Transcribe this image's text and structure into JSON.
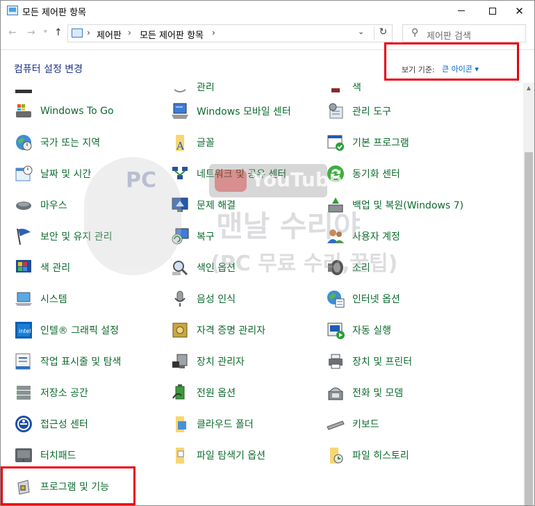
{
  "window": {
    "title": "모든 제어판 항목"
  },
  "titlebar": {
    "minimize": "—",
    "maximize": "☐",
    "close": "✕"
  },
  "nav": {
    "back": "←",
    "forward": "→",
    "up": "↑",
    "dropdown": "▾",
    "refresh": "↻"
  },
  "address": {
    "segments": [
      "제어판",
      "모든 제어판 항목"
    ],
    "separator": "›",
    "dropdown": "⌄"
  },
  "search": {
    "placeholder": "제어판 검색"
  },
  "header": {
    "title": "컴퓨터 설정 변경",
    "view_label": "보기 기준:",
    "view_value": "큰 아이콘 ▾"
  },
  "highlight_color": "#e8000b",
  "link_color": "#0d6b2e",
  "items": {
    "col1": [
      {
        "label": "",
        "icon": "partial-icon"
      },
      {
        "label": "Windows To Go",
        "icon": "usb-drive-icon"
      },
      {
        "label": "국가 또는 지역",
        "icon": "globe-clock-icon"
      },
      {
        "label": "날짜 및 시간",
        "icon": "calendar-clock-icon"
      },
      {
        "label": "마우스",
        "icon": "mouse-icon"
      },
      {
        "label": "보안 및 유지 관리",
        "icon": "flag-icon"
      },
      {
        "label": "색 관리",
        "icon": "color-management-icon"
      },
      {
        "label": "시스템",
        "icon": "system-laptop-icon"
      },
      {
        "label": "인텔® 그래픽 설정",
        "icon": "intel-graphics-icon"
      },
      {
        "label": "작업 표시줄 및 탐색",
        "icon": "taskbar-icon"
      },
      {
        "label": "저장소 공간",
        "icon": "storage-spaces-icon"
      },
      {
        "label": "접근성 센터",
        "icon": "ease-of-access-icon"
      },
      {
        "label": "터치패드",
        "icon": "touchpad-icon"
      },
      {
        "label": "프로그램 및 기능",
        "icon": "programs-features-icon"
      }
    ],
    "col2": [
      {
        "label": "관리",
        "icon": "partial-icon"
      },
      {
        "label": "Windows 모바일 센터",
        "icon": "mobility-center-icon"
      },
      {
        "label": "글꼴",
        "icon": "fonts-folder-icon"
      },
      {
        "label": "네트워크 및 공유 센터",
        "icon": "network-icon"
      },
      {
        "label": "문제 해결",
        "icon": "troubleshoot-icon"
      },
      {
        "label": "복구",
        "icon": "recovery-icon"
      },
      {
        "label": "색인 옵션",
        "icon": "indexing-icon"
      },
      {
        "label": "음성 인식",
        "icon": "microphone-icon"
      },
      {
        "label": "자격 증명 관리자",
        "icon": "credential-vault-icon"
      },
      {
        "label": "장치 관리자",
        "icon": "device-manager-icon"
      },
      {
        "label": "전원 옵션",
        "icon": "power-options-icon"
      },
      {
        "label": "클라우드 폴더",
        "icon": "cloud-folder-icon"
      },
      {
        "label": "파일 탐색기 옵션",
        "icon": "folder-options-icon"
      }
    ],
    "col3": [
      {
        "label": "색",
        "icon": "partial-icon"
      },
      {
        "label": "관리 도구",
        "icon": "admin-tools-icon"
      },
      {
        "label": "기본 프로그램",
        "icon": "default-programs-icon"
      },
      {
        "label": "동기화 센터",
        "icon": "sync-center-icon"
      },
      {
        "label": "백업 및 복원(Windows 7)",
        "icon": "backup-restore-icon"
      },
      {
        "label": "사용자 계정",
        "icon": "user-accounts-icon"
      },
      {
        "label": "소리",
        "icon": "speaker-icon"
      },
      {
        "label": "인터넷 옵션",
        "icon": "internet-options-icon"
      },
      {
        "label": "자동 실행",
        "icon": "autoplay-icon"
      },
      {
        "label": "장치 및 프린터",
        "icon": "devices-printers-icon"
      },
      {
        "label": "전화 및 모뎀",
        "icon": "phone-modem-icon"
      },
      {
        "label": "키보드",
        "icon": "keyboard-icon"
      },
      {
        "label": "파일 히스토리",
        "icon": "file-history-icon"
      }
    ]
  },
  "watermark": {
    "brand": "PC",
    "video": "YouTube",
    "line1": "맨날 수리야",
    "line2": "(PC 무료 수리,꿀팁)"
  }
}
